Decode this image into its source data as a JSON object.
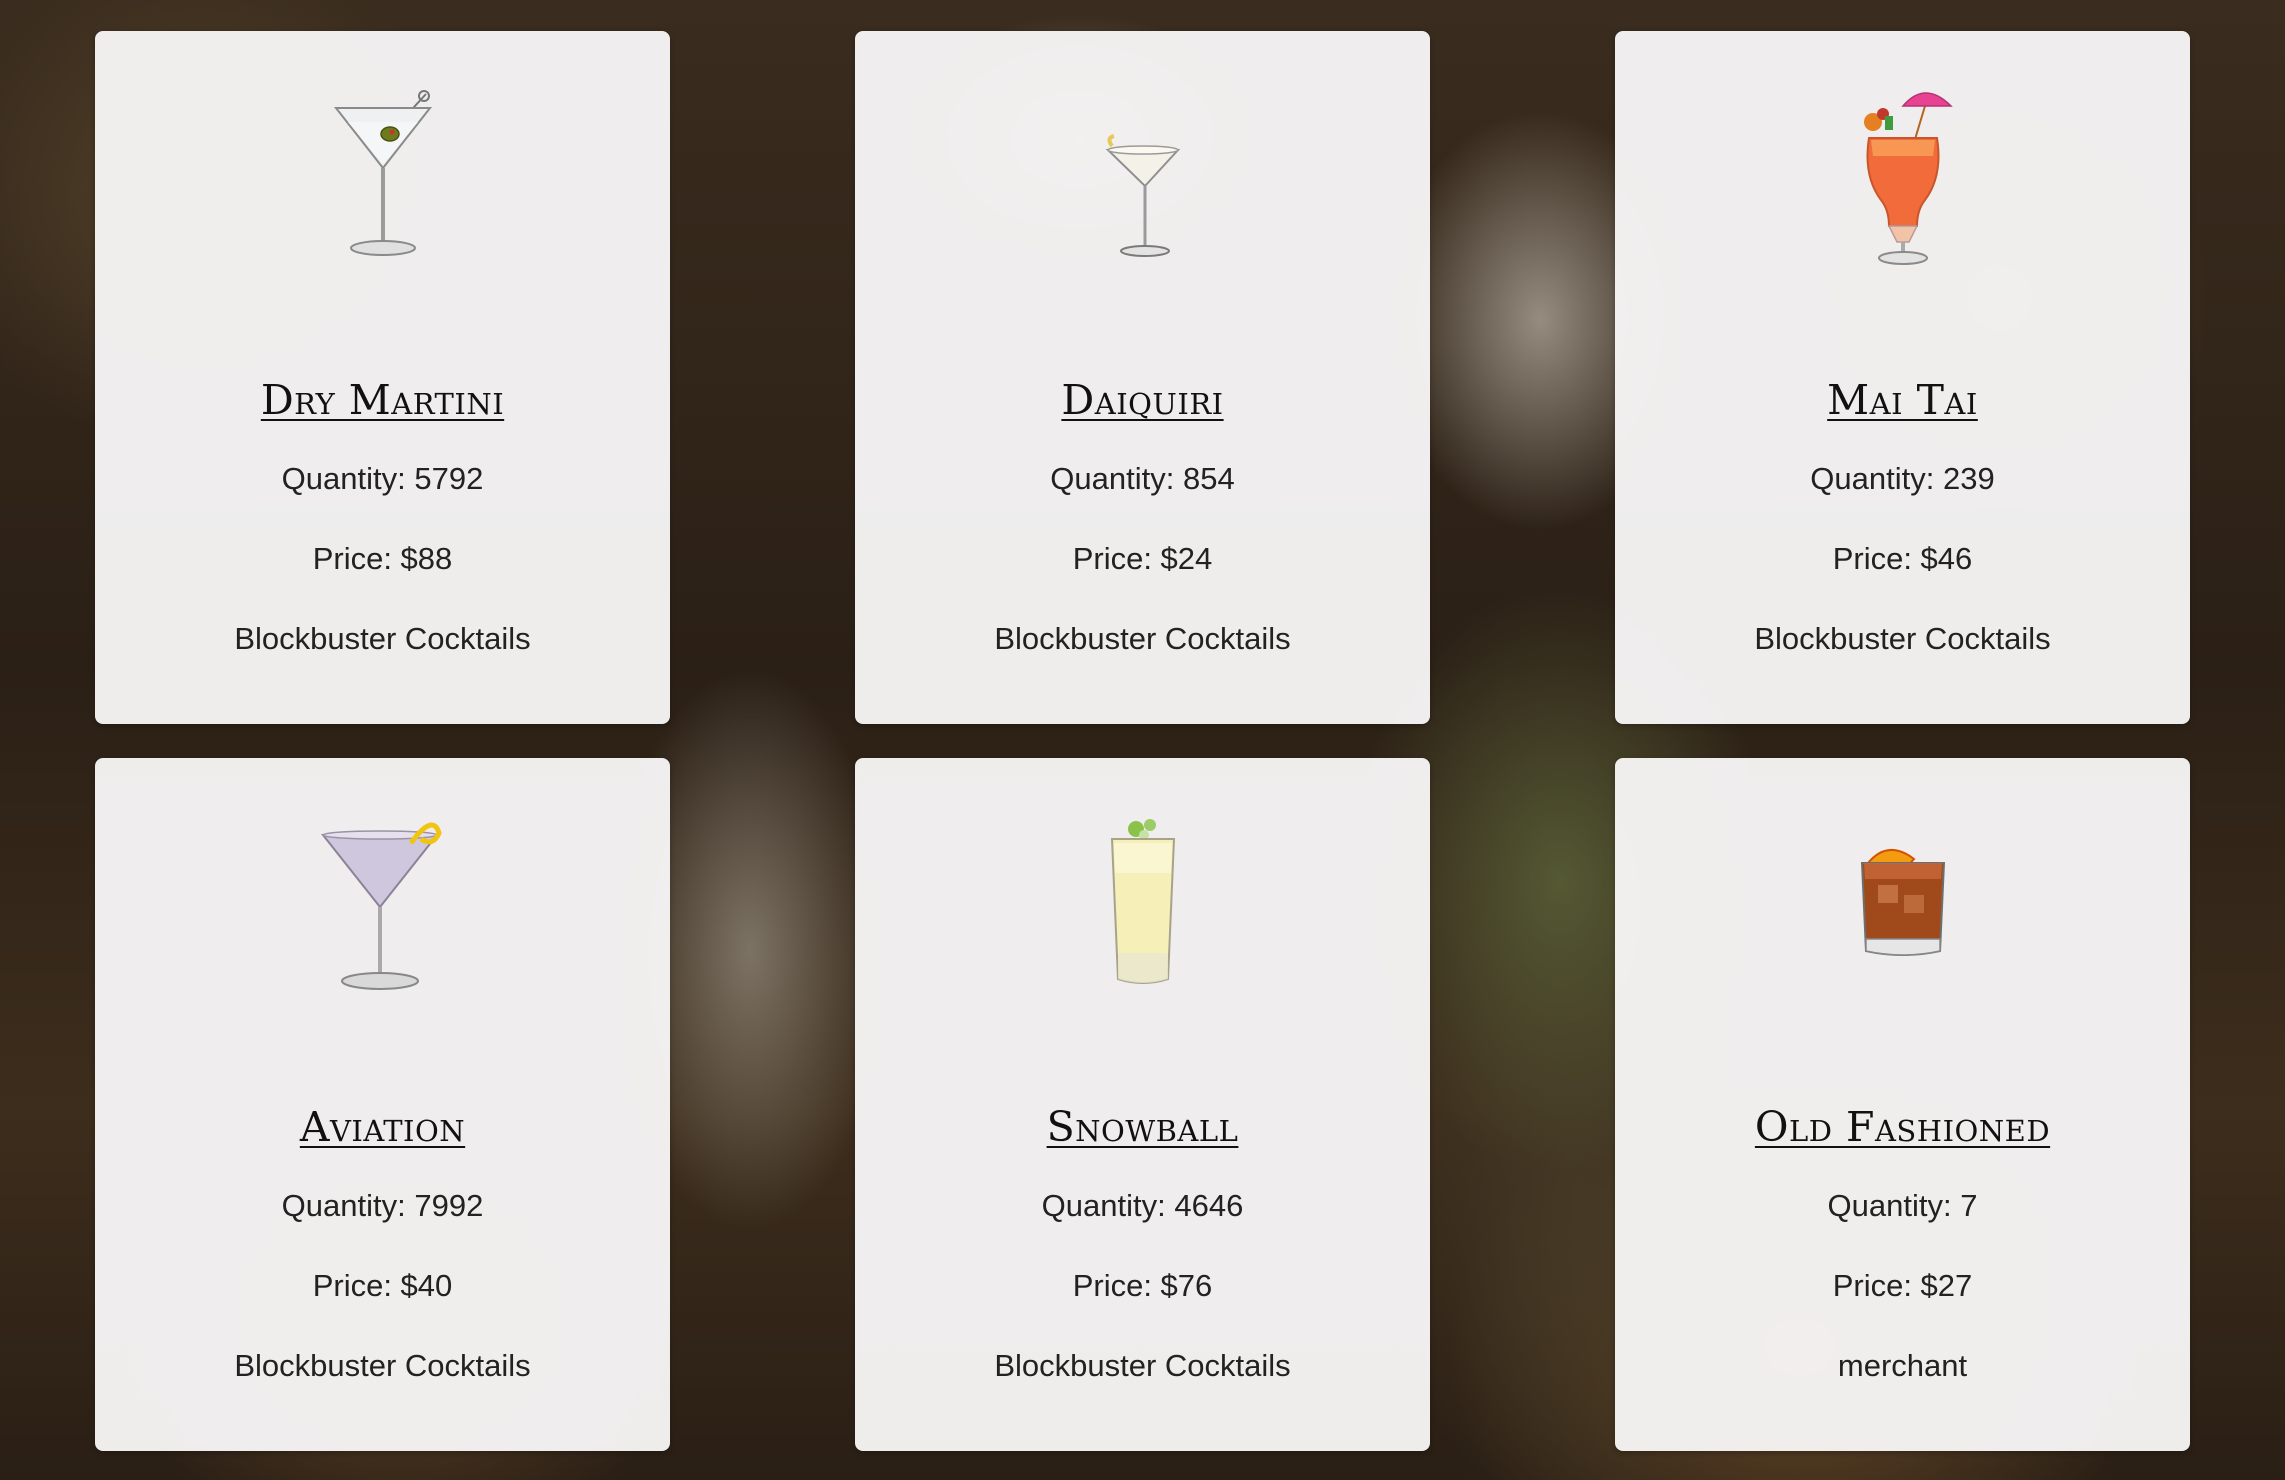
{
  "cocktails": [
    {
      "name": "Dry Martini",
      "quantity": "Quantity: 5792",
      "price": "Price: $88",
      "seller": "Blockbuster Cocktails",
      "image_icon": "martini-glass-olive-icon"
    },
    {
      "name": "Daiquiri",
      "quantity": "Quantity: 854",
      "price": "Price: $24",
      "seller": "Blockbuster Cocktails",
      "image_icon": "daiquiri-glass-icon"
    },
    {
      "name": "Mai Tai",
      "quantity": "Quantity: 239",
      "price": "Price: $46",
      "seller": "Blockbuster Cocktails",
      "image_icon": "hurricane-glass-umbrella-icon"
    },
    {
      "name": "Aviation",
      "quantity": "Quantity: 7992",
      "price": "Price: $40",
      "seller": "Blockbuster Cocktails",
      "image_icon": "martini-glass-lemon-twist-icon"
    },
    {
      "name": "Snowball",
      "quantity": "Quantity: 4646",
      "price": "Price: $76",
      "seller": "Blockbuster Cocktails",
      "image_icon": "highball-glass-lime-icon"
    },
    {
      "name": "Old Fashioned",
      "quantity": "Quantity: 7",
      "price": "Price: $27",
      "seller": "merchant",
      "image_icon": "rocks-glass-orange-icon"
    }
  ],
  "colors": {
    "card_background": "#f7f6f6",
    "text": "#222222",
    "title": "#111111"
  }
}
